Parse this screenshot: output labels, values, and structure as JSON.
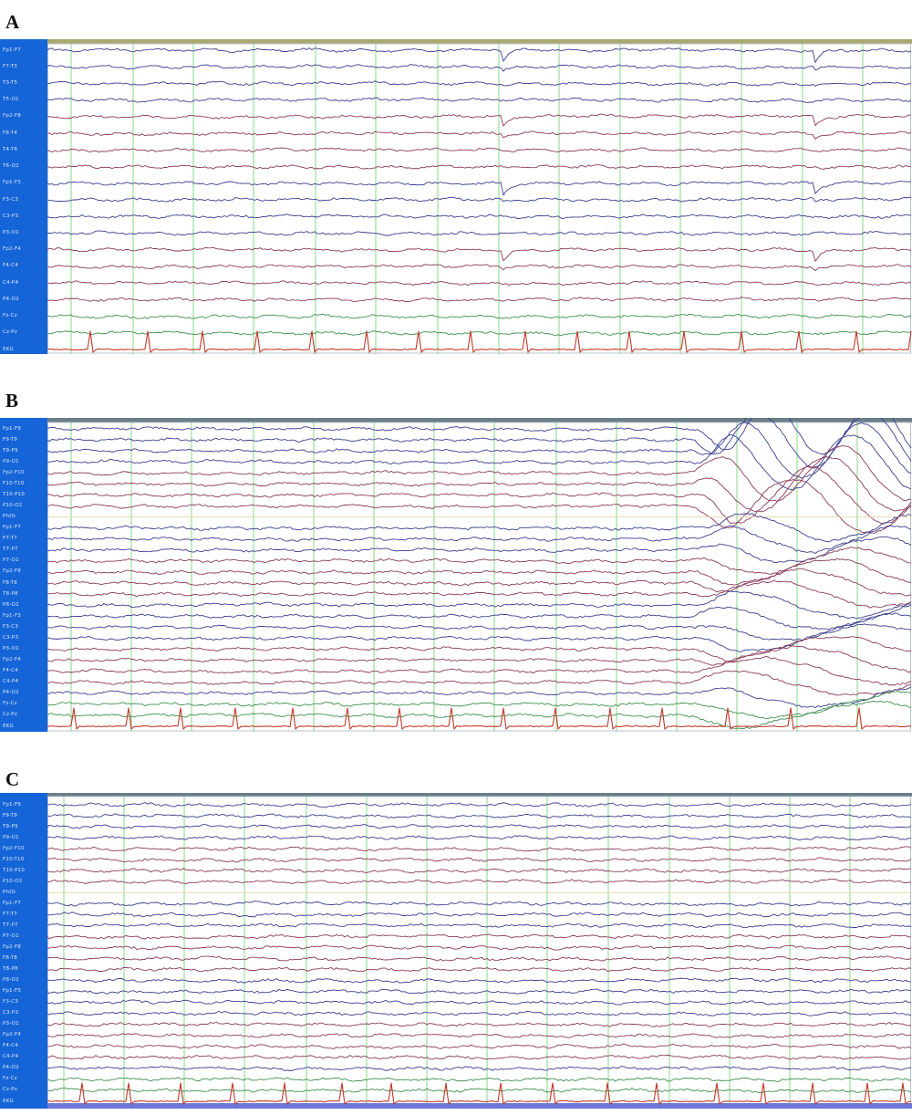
{
  "figure": {
    "panel_count": 3
  },
  "colors": {
    "sidebar": "#1565d8",
    "sidebar_text": "#dfe9ff",
    "grid_line": "#8fdc8f",
    "trace_blue": "#3a3f8f",
    "trace_maroon": "#8a3a5a",
    "trace_green": "#3f8f4f",
    "ecg": "#c0392b",
    "top_bar_a": "#a8a870",
    "top_bar_b": "#6a7e88",
    "top_bar_c": "#6a7e88",
    "bottom_bar_c": "#6c77d8"
  },
  "panels": [
    {
      "letter": "A",
      "top_bar_color": "#a8a870",
      "channels": [
        "Fp1-F7",
        "F7-T3",
        "T3-T5",
        "T5-O1",
        "Fp2-F8",
        "F8-T4",
        "T4-T6",
        "T6-O2",
        "Fp1-F3",
        "F3-C3",
        "C3-P3",
        "P3-O1",
        "Fp2-F4",
        "F4-C4",
        "C4-P4",
        "P4-O2",
        "Fz-Cz",
        "Cz-Pz",
        "EKG"
      ],
      "bottom_bar": false
    },
    {
      "letter": "B",
      "top_bar_color": "#6a7e88",
      "channels": [
        "Fp1-F9",
        "F9-T9",
        "T9-P9",
        "P9-O1",
        "Fp2-F10",
        "F10-T10",
        "T10-P10",
        "P10-O2",
        "PhOt",
        "Fp1-F7",
        "F7-T7",
        "T7-P7",
        "P7-O1",
        "Fp2-F8",
        "F8-T8",
        "T8-P8",
        "P8-O2",
        "Fp1-F3",
        "F3-C3",
        "C3-P3",
        "P3-O1",
        "Fp2-F4",
        "F4-C4",
        "C4-P4",
        "P4-O2",
        "Fz-Cz",
        "Cz-Pz",
        "EKG"
      ],
      "bottom_bar": false
    },
    {
      "letter": "C",
      "top_bar_color": "#6a7e88",
      "channels": [
        "Fp1-F9",
        "F9-T9",
        "T9-P9",
        "P9-O1",
        "Fp2-F10",
        "F10-T10",
        "T10-P10",
        "P10-O2",
        "PhOt",
        "Fp1-F7",
        "F7-T7",
        "T7-P7",
        "P7-O1",
        "Fp2-F8",
        "F8-T8",
        "T8-P8",
        "P8-O2",
        "Fp1-F3",
        "F3-C3",
        "C3-P3",
        "P3-O1",
        "Fp2-F4",
        "F4-C4",
        "C4-P4",
        "P4-O2",
        "Fz-Cz",
        "Cz-Pz",
        "EKG"
      ],
      "bottom_bar": true
    }
  ]
}
